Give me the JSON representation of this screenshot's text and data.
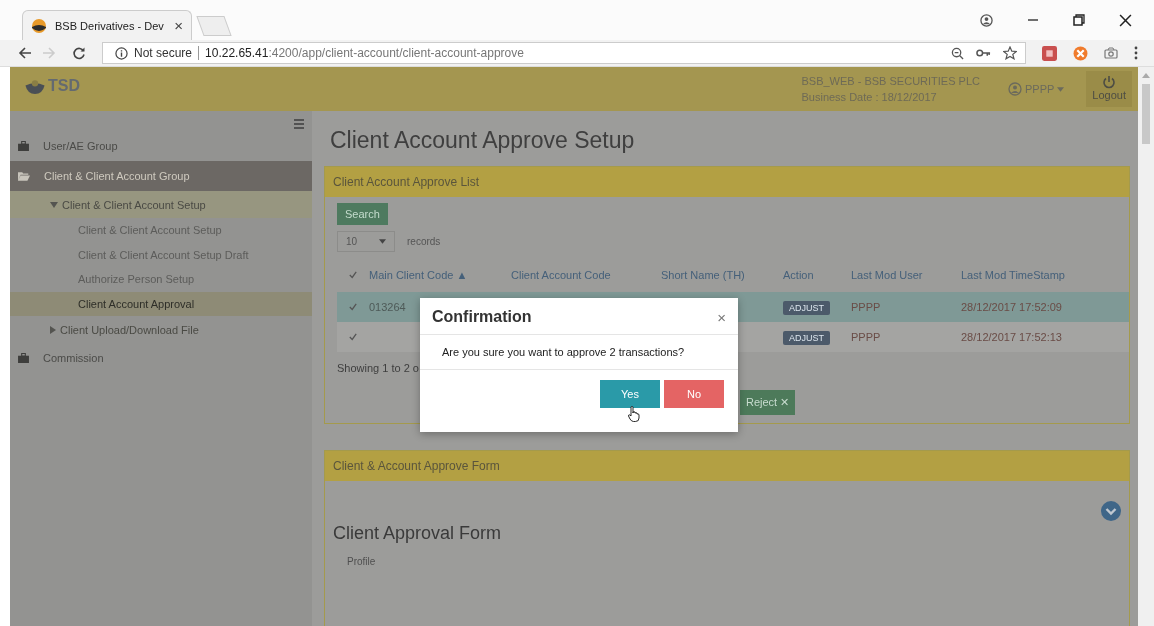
{
  "browser": {
    "tab_title": "BSB Derivatives - Dev",
    "tab_close": "×",
    "security": "Not secure",
    "url_host": "10.22.65.41",
    "url_path": ":4200/app/client-account/client-account-approve"
  },
  "header": {
    "logo": "TSD",
    "company": "BSB_WEB - BSB SECURITIES PLC",
    "business_date": "Business Date : 18/12/2017",
    "user": "PPPP",
    "logout": "Logout"
  },
  "sidebar": {
    "items": [
      {
        "label": "User/AE Group",
        "expanded": false,
        "selected": false
      },
      {
        "label": "Client & Client Account Group",
        "expanded": true,
        "selected": false,
        "children": [
          {
            "label": "Client & Client Account Setup",
            "expanded": true,
            "selected": false,
            "children": [
              {
                "label": "Client & Client Account Setup",
                "selected": false
              },
              {
                "label": "Client & Client Account Setup Draft",
                "selected": false
              },
              {
                "label": "Authorize Person Setup",
                "selected": false
              },
              {
                "label": "Client Account Approval",
                "selected": true
              }
            ]
          },
          {
            "label": "Client Upload/Download File",
            "expanded": false,
            "selected": false
          }
        ]
      },
      {
        "label": "Commission",
        "expanded": false,
        "selected": false
      }
    ]
  },
  "page_title": "Client Account Approve Setup",
  "list_panel": {
    "title": "Client Account Approve List",
    "search_button": "Search",
    "page_size": "10",
    "records_label": "records",
    "columns": [
      "Main Client Code ▲",
      "Client Account Code",
      "Short Name (TH)",
      "Action",
      "Last Mod User",
      "Last Mod TimeStamp"
    ],
    "rows": [
      {
        "selected": true,
        "checked": true,
        "main_client_code": "013264",
        "action": "ADJUST",
        "last_mod_user": "PPPP",
        "timestamp": "28/12/2017 17:52:09"
      },
      {
        "selected": false,
        "checked": true,
        "main_client_code": "",
        "action": "ADJUST",
        "last_mod_user": "PPPP",
        "timestamp": "28/12/2017 17:52:13"
      }
    ],
    "showing": "Showing 1 to 2 o",
    "reject_button": "Reject ✕"
  },
  "form_panel": {
    "title": "Client & Account Approve Form",
    "form_title": "Client Approval Form",
    "section": "Profile"
  },
  "dialog": {
    "title": "Confirmation",
    "close": "×",
    "message": "Are you sure you want to approve 2 transactions?",
    "yes": "Yes",
    "no": "No"
  }
}
